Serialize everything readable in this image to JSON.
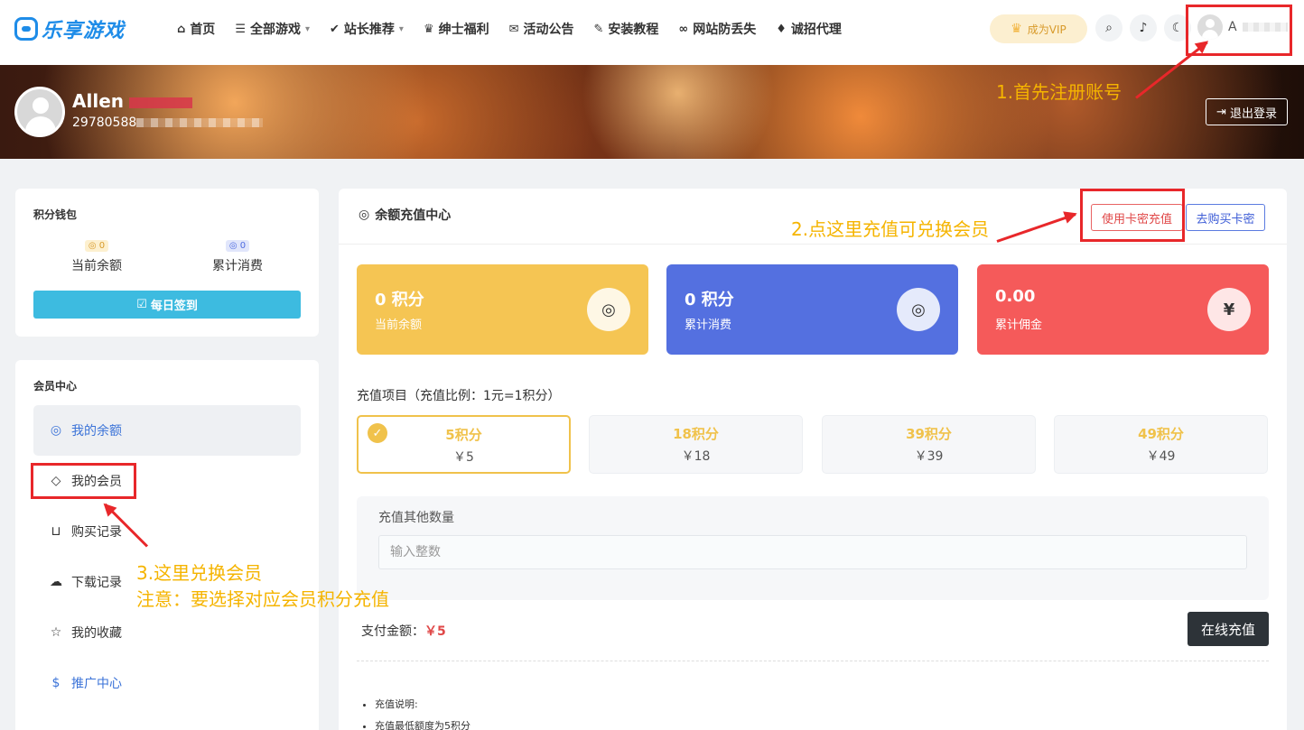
{
  "header": {
    "logo_text": "乐享游戏",
    "nav": [
      {
        "icon": "home-icon",
        "glyph": "⌂",
        "label": "首页",
        "caret": false
      },
      {
        "icon": "list-icon",
        "glyph": "☰",
        "label": "全部游戏",
        "caret": true
      },
      {
        "icon": "thumbs-up-icon",
        "glyph": "✔",
        "label": "站长推荐",
        "caret": true
      },
      {
        "icon": "crown-icon",
        "glyph": "♛",
        "label": "绅士福利",
        "caret": false
      },
      {
        "icon": "megaphone-icon",
        "glyph": "✉",
        "label": "活动公告",
        "caret": false
      },
      {
        "icon": "puzzle-icon",
        "glyph": "✎",
        "label": "安装教程",
        "caret": false
      },
      {
        "icon": "link-icon",
        "glyph": "∞",
        "label": "网站防丢失",
        "caret": false
      },
      {
        "icon": "diamond-icon",
        "glyph": "♦",
        "label": "诚招代理",
        "caret": false
      }
    ],
    "vip_label": "成为VIP",
    "user_name": "A"
  },
  "banner": {
    "name": "Allen",
    "email": "29780588"
  },
  "logout_label": "退出登录",
  "annotations": {
    "step1": "1.首先注册账号",
    "step2": "2.点这里充值可兑换会员",
    "step3_line1": "3.这里兑换会员",
    "step3_line2": "注意：要选择对应会员积分充值"
  },
  "wallet": {
    "title": "积分钱包",
    "balance_badge": "0",
    "balance_label": "当前余额",
    "spent_badge": "0",
    "spent_label": "累计消费",
    "checkin_label": "每日签到"
  },
  "member_center": {
    "title": "会员中心",
    "items": [
      {
        "label": "我的余额",
        "icon": "coins-icon",
        "glyph": "◎"
      },
      {
        "label": "我的会员",
        "icon": "diamond-icon",
        "glyph": "◇"
      },
      {
        "label": "购买记录",
        "icon": "basket-icon",
        "glyph": "⊔"
      },
      {
        "label": "下载记录",
        "icon": "cloud-download-icon",
        "glyph": "☁"
      },
      {
        "label": "我的收藏",
        "icon": "star-icon",
        "glyph": "☆"
      },
      {
        "label": "推广中心",
        "icon": "hand-dollar-icon",
        "glyph": "$"
      }
    ]
  },
  "main": {
    "title": "余额充值中心",
    "use_card_label": "使用卡密充值",
    "buy_card_label": "去购买卡密",
    "stats": [
      {
        "value": "0 积分",
        "label": "当前余额",
        "color": "#f5c553",
        "icon_glyph": "◎"
      },
      {
        "value": "0 积分",
        "label": "累计消费",
        "color": "#5470e0",
        "icon_glyph": "◎"
      },
      {
        "value": "0.00",
        "label": "累计佣金",
        "color": "#f55a5a",
        "icon_glyph": "¥"
      }
    ],
    "project_label": "充值项目（充值比例：1元=1积分）",
    "packages": [
      {
        "points": "5积分",
        "price": "￥5",
        "selected": true
      },
      {
        "points": "18积分",
        "price": "￥18",
        "selected": false
      },
      {
        "points": "39积分",
        "price": "￥39",
        "selected": false
      },
      {
        "points": "49积分",
        "price": "￥49",
        "selected": false
      }
    ],
    "other_label": "充值其他数量",
    "other_placeholder": "输入整数",
    "pay_label": "支付金额：",
    "pay_amount": "￥5",
    "pay_button": "在线充值",
    "notes": [
      "充值说明:",
      "充值最低额度为5积分"
    ]
  }
}
